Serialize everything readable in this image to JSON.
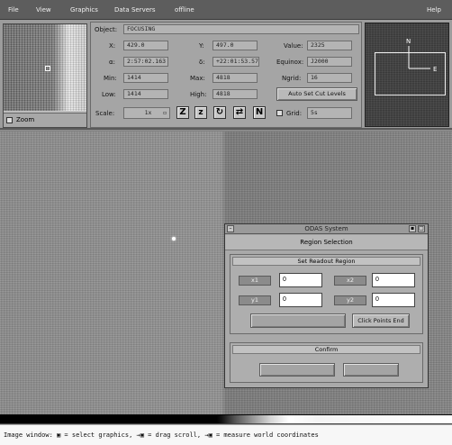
{
  "menu": {
    "file": "File",
    "view": "View",
    "graphics": "Graphics",
    "data_servers": "Data Servers",
    "offline": "offline",
    "help": "Help"
  },
  "magnifier": {
    "zoom_label": "Zoom"
  },
  "info": {
    "object_label": "Object:",
    "object_value": "FOCUSING",
    "x_label": "X:",
    "x_value": "429.0",
    "y_label": "Y:",
    "y_value": "497.0",
    "value_label": "Value:",
    "value_value": "2325",
    "alpha_label": "α:",
    "alpha_value": "2:57:02.163",
    "delta_label": "δ:",
    "delta_value": "+22:01:53.57",
    "equinox_label": "Equinox:",
    "equinox_value": "J2000",
    "min_label": "Min:",
    "min_value": "1414",
    "max_label": "Max:",
    "max_value": "4818",
    "ngrid_label": "Ngrid:",
    "ngrid_value": "16",
    "low_label": "Low:",
    "low_value": "1414",
    "high_label": "High:",
    "high_value": "4818",
    "auto_cut_label": "Auto Set Cut Levels",
    "scale_label": "Scale:",
    "scale_value": "1x",
    "grid_label": "Grid:",
    "grid_value": "5s"
  },
  "tools": {
    "zoom_in": "Z",
    "zoom_out": "z",
    "rotate": "↻",
    "flip": "⇄",
    "north": "N"
  },
  "dialog": {
    "title": "ODAS System",
    "subtitle": "Region Selection",
    "readout_group": "Set Readout Region",
    "x1_label": "x1",
    "x1_value": "0",
    "x2_label": "x2",
    "x2_value": "0",
    "y1_label": "y1",
    "y1_value": "0",
    "y2_label": "y2",
    "y2_value": "0",
    "click_points_end": "Click Points End",
    "confirm_group": "Confirm"
  },
  "status": {
    "text": "Image window:  ▣ = select graphics,  →▣ = drag scroll,  →▣ = measure world coordinates"
  }
}
